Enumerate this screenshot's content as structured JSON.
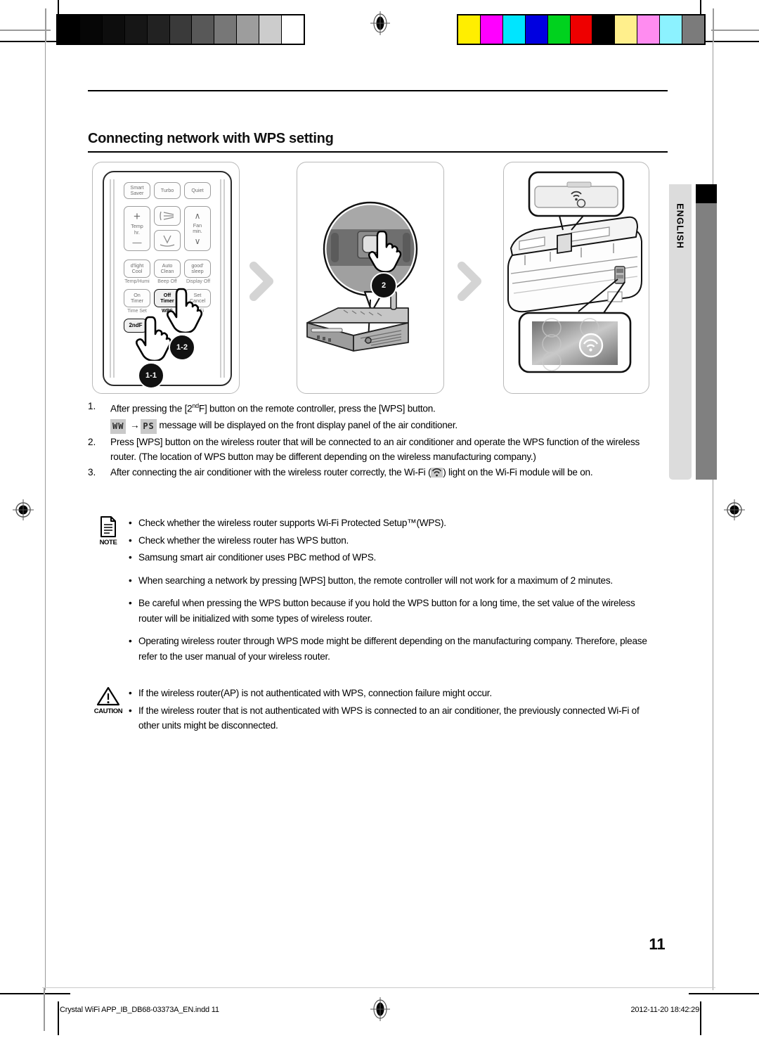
{
  "document": {
    "title": "Connecting network with WPS setting",
    "page_number": "11",
    "side_tab": "ENGLISH"
  },
  "figure": {
    "panels": [
      {
        "name": "remote-controller",
        "badges": [
          "1-1",
          "1-2"
        ]
      },
      {
        "name": "wireless-router",
        "badges": [
          "2"
        ]
      },
      {
        "name": "air-conditioner-wifi-module",
        "badges": []
      }
    ],
    "arrow_icon": "chevron-right-icon",
    "remote": {
      "row1": [
        {
          "label_top": "Smart",
          "label_bottom": "Saver"
        },
        {
          "label_top": "Turbo",
          "label_bottom": ""
        },
        {
          "label_top": "Quiet",
          "label_bottom": ""
        }
      ],
      "temp_button": {
        "plus": "+",
        "label_top": "Temp",
        "label_bottom": "hr.",
        "minus": "—"
      },
      "fan_button": {
        "up": "∧",
        "label_top": "Fan",
        "label_bottom": "min.",
        "down": "∨"
      },
      "swing_icons": [
        "swing-horizontal-icon",
        "swing-vertical-icon"
      ],
      "row3": [
        {
          "label_top": "d'light",
          "label_bottom": "Cool",
          "sub": "Temp/Humi"
        },
        {
          "label_top": "Auto",
          "label_bottom": "Clean",
          "sub": "Beep Off"
        },
        {
          "label_top": "good'",
          "label_bottom": "sleep",
          "sub": "Display Off"
        }
      ],
      "row4": [
        {
          "label_top": "On",
          "label_bottom": "Timer",
          "sub": "Time Set",
          "highlight": false
        },
        {
          "label_top": "Off",
          "label_bottom": "Timer",
          "sub": "WPS",
          "highlight": true
        },
        {
          "label_top": "Set",
          "label_bottom": "Cancel",
          "sub": "Wi-Fi",
          "highlight": false
        }
      ],
      "second_f_button": "2ndF"
    }
  },
  "steps": [
    {
      "num": "1.",
      "text_before": "After pressing the [2",
      "sup": "nd",
      "text_mid": "F] button on the remote controller, press the [WPS] button.",
      "line2_seg1": "WW",
      "line2_arrow": "→",
      "line2_seg2": "PS",
      "line2_text": "message will be displayed on the front display panel of the air conditioner."
    },
    {
      "num": "2.",
      "text": "Press [WPS] button on the wireless router that will be connected to an air conditioner and operate the WPS function of the wireless router. (The location of WPS button may be different depending on the wireless manufacturing company.)"
    },
    {
      "num": "3.",
      "text_before": "After connecting the air conditioner with the wireless router correctly, the Wi-Fi (",
      "icon": "wifi-icon",
      "text_after": ") light on the Wi-Fi module will be on."
    }
  ],
  "note": {
    "caption": "NOTE",
    "icon": "document-icon",
    "bullet_char": "•",
    "items": [
      "Check whether the wireless router supports Wi-Fi Protected Setup™(WPS).",
      "Check whether the wireless router has WPS button.",
      "Samsung smart air conditioner uses PBC method of WPS.",
      "When searching a network by pressing [WPS] button, the remote controller will not work for a maximum of 2 minutes.",
      "Be careful when pressing the WPS button because if you hold the WPS button for a long time, the set value of the wireless router will be initialized with some types of wireless router.",
      "Operating wireless router through WPS mode might be different depending on the manufacturing company. Therefore, please refer to the user manual of your wireless router."
    ]
  },
  "caution": {
    "caption": "CAUTION",
    "icon": "warning-triangle-icon",
    "bullet_char": "•",
    "items": [
      "If the wireless router(AP) is not authenticated with WPS, connection failure might occur.",
      "If the wireless router that is not authenticated with WPS is connected to an air conditioner, the previously connected Wi-Fi of other units might be disconnected."
    ]
  },
  "footer": {
    "file_name": "Crystal WiFi APP_IB_DB68-03373A_EN.indd   11",
    "timestamp": "2012-11-20   18:42:29"
  },
  "print_marks": {
    "grayscale_bar": [
      "#000000",
      "#060606",
      "#0d0d0d",
      "#161616",
      "#222222",
      "#3a3a3a",
      "#585858",
      "#777777",
      "#9d9d9d",
      "#cccccc",
      "#ffffff"
    ],
    "color_bar": [
      "#ffee00",
      "#ff00ff",
      "#00e5ff",
      "#0000e0",
      "#00d21e",
      "#ee0000",
      "#000000",
      "#ffef8c",
      "#ff8cf0",
      "#8cf2ff",
      "#7b7b7b"
    ],
    "registration_icon": "registration-target-icon"
  }
}
